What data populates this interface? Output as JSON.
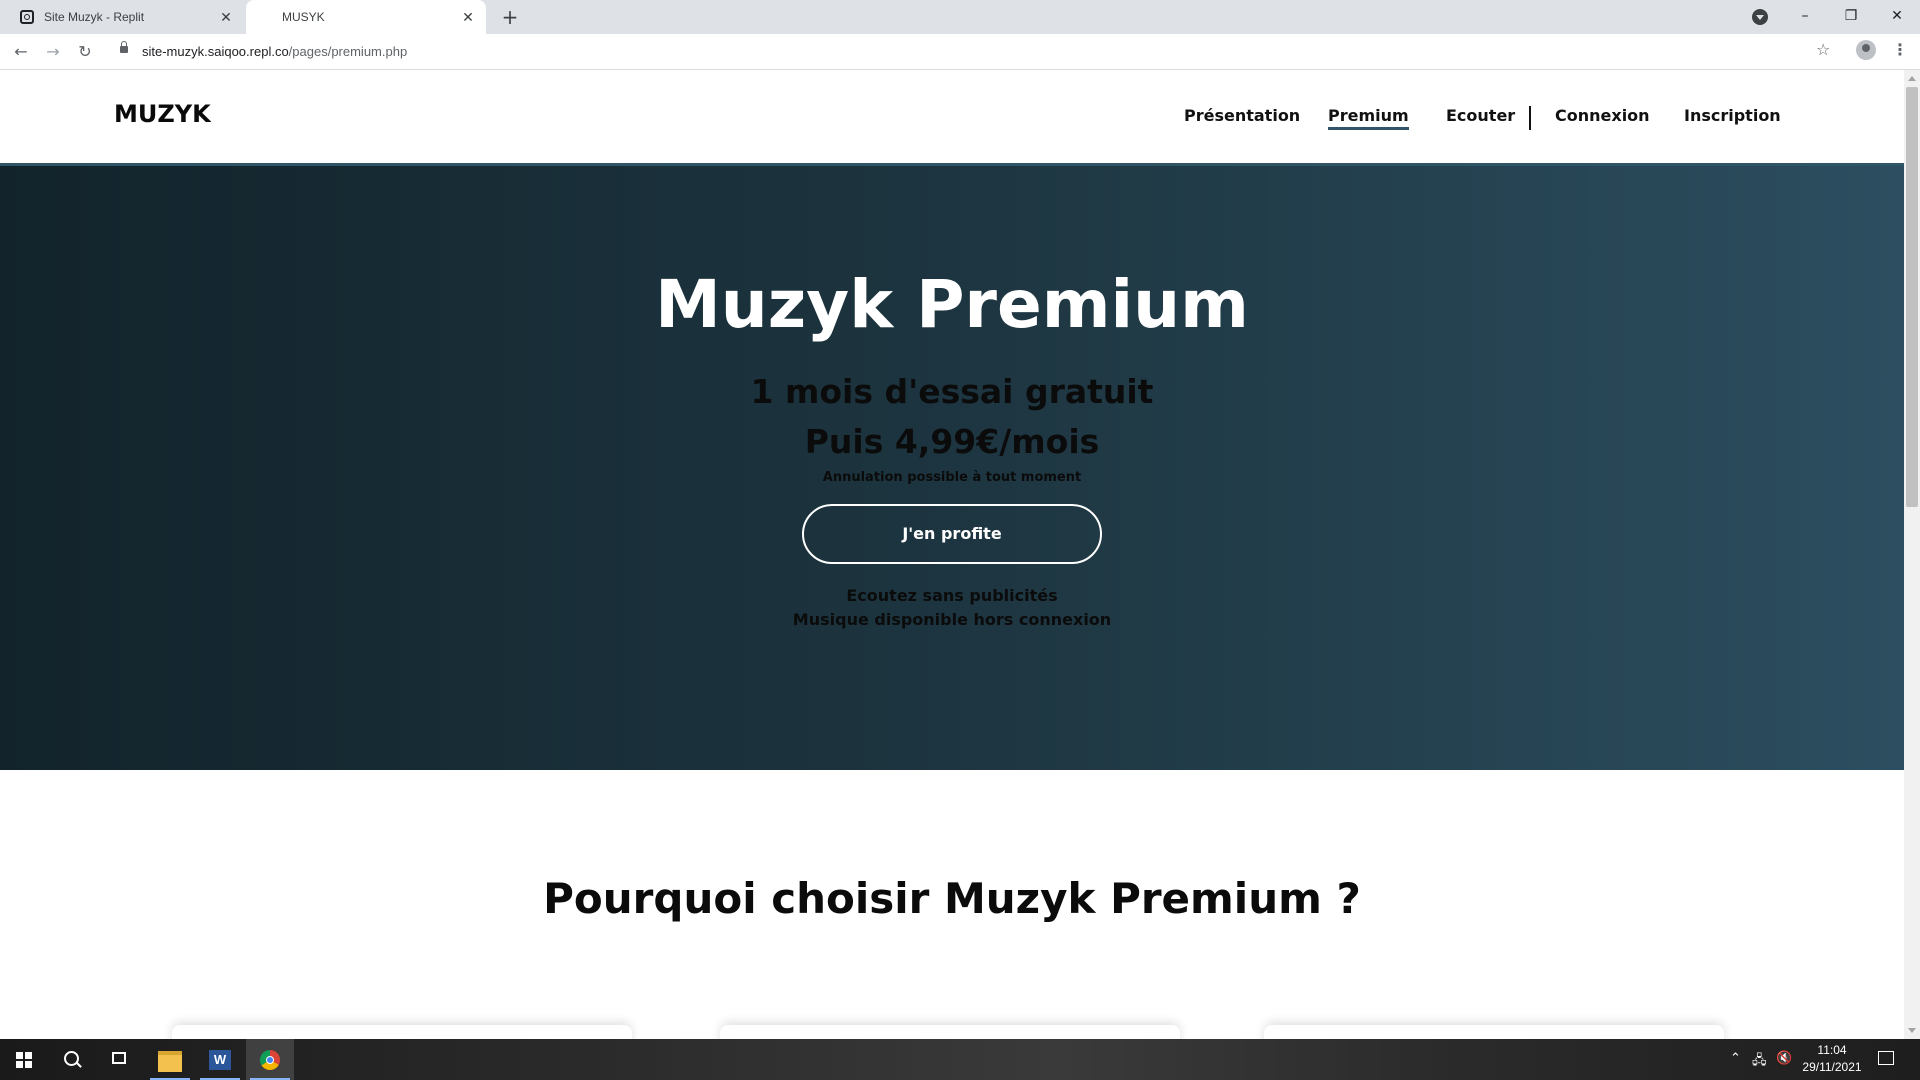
{
  "browser": {
    "tabs": [
      {
        "label": "Site Muzyk - Replit",
        "active": false
      },
      {
        "label": "MUSYK",
        "active": true
      }
    ],
    "new_tab_label": "+",
    "window_controls": {
      "minimize": "–",
      "restore": "❐",
      "close": "✕"
    },
    "url_host": "site-muzyk.saiqoo.repl.co",
    "url_path": "/pages/premium.php",
    "icons": [
      "back-arrow-icon",
      "forward-arrow-icon",
      "reload-icon",
      "lock-icon",
      "star-icon",
      "profile-icon",
      "menu-icon"
    ]
  },
  "site": {
    "logo": "MUZYK",
    "nav": [
      {
        "label": "Présentation",
        "active": false
      },
      {
        "label": "Premium",
        "active": true
      },
      {
        "label": "Ecouter",
        "active": false
      },
      {
        "label": "Connexion",
        "active": false
      },
      {
        "label": "Inscription",
        "active": false
      }
    ],
    "accent_color": "#2f5566"
  },
  "hero": {
    "title": "Muzyk Premium",
    "offer_line1": "1 mois d'essai gratuit",
    "offer_line2": "Puis 4,99€/mois",
    "note": "Annulation possible à tout moment",
    "cta_label": "J'en profite",
    "features": [
      "Ecoutez sans publicités",
      "Musique disponible hors connexion"
    ],
    "gradient_colors": [
      "#12232b",
      "#2c4e60"
    ]
  },
  "section": {
    "title": "Pourquoi choisir Muzyk Premium ?"
  },
  "taskbar": {
    "time": "11:04",
    "date": "29/11/2021",
    "apps": [
      "windows-start-icon",
      "search-icon",
      "task-view-icon",
      "file-explorer-icon",
      "word-icon",
      "chrome-icon"
    ]
  }
}
